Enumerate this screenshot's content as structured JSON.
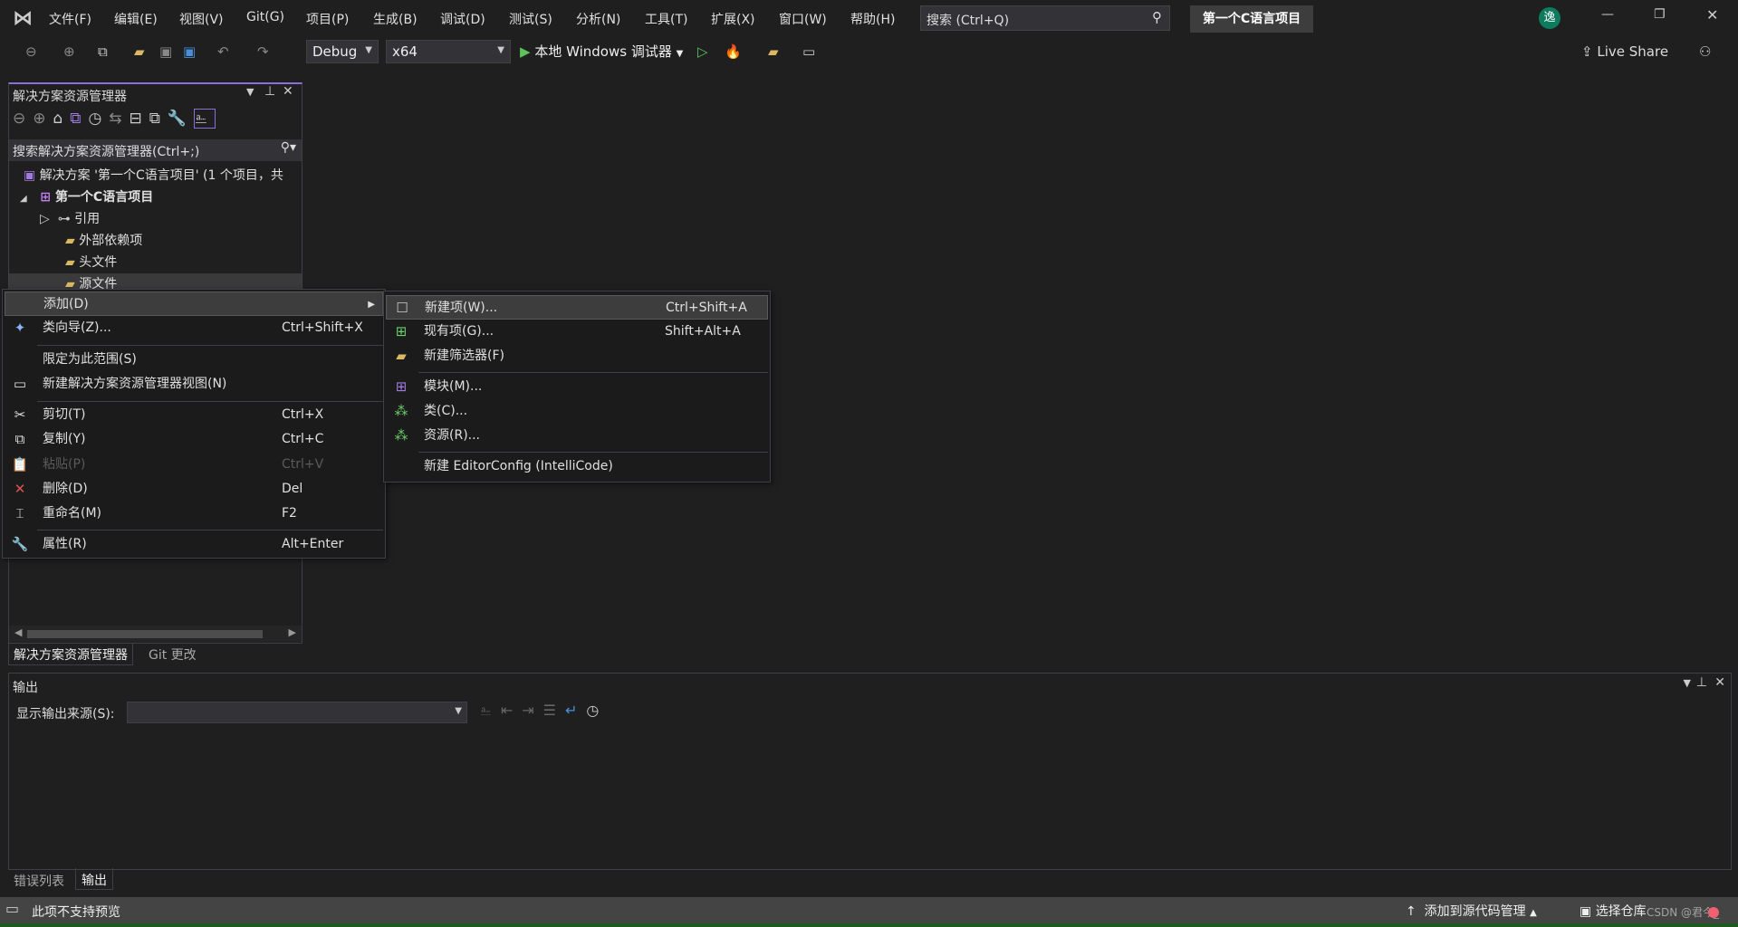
{
  "menubar": {
    "items": [
      "文件(F)",
      "编辑(E)",
      "视图(V)",
      "Git(G)",
      "项目(P)",
      "生成(B)",
      "调试(D)",
      "测试(S)",
      "分析(N)",
      "工具(T)",
      "扩展(X)",
      "窗口(W)",
      "帮助(H)"
    ],
    "search_placeholder": "搜索 (Ctrl+Q)",
    "project_title": "第一个C语言项目",
    "avatar": "逸"
  },
  "toolbar": {
    "config": "Debug",
    "platform": "x64",
    "run_label": "本地 Windows 调试器",
    "live_share": "Live Share"
  },
  "solution_explorer": {
    "title": "解决方案资源管理器",
    "search_placeholder": "搜索解决方案资源管理器(Ctrl+;)",
    "tree": [
      "解决方案 '第一个C语言项目' (1 个项目，共",
      "第一个C语言项目",
      "引用",
      "外部依赖项",
      "头文件",
      "源文件"
    ],
    "tabs": [
      "解决方案资源管理器",
      "Git 更改"
    ]
  },
  "context_menu": {
    "items": [
      {
        "label": "添加(D)",
        "shortcut": ""
      },
      {
        "label": "类向导(Z)...",
        "shortcut": "Ctrl+Shift+X"
      },
      {
        "label": "限定为此范围(S)",
        "shortcut": ""
      },
      {
        "label": "新建解决方案资源管理器视图(N)",
        "shortcut": ""
      },
      {
        "label": "剪切(T)",
        "shortcut": "Ctrl+X"
      },
      {
        "label": "复制(Y)",
        "shortcut": "Ctrl+C"
      },
      {
        "label": "粘贴(P)",
        "shortcut": "Ctrl+V",
        "disabled": true
      },
      {
        "label": "删除(D)",
        "shortcut": "Del"
      },
      {
        "label": "重命名(M)",
        "shortcut": "F2"
      },
      {
        "label": "属性(R)",
        "shortcut": "Alt+Enter"
      }
    ]
  },
  "submenu": {
    "items": [
      {
        "label": "新建项(W)...",
        "shortcut": "Ctrl+Shift+A"
      },
      {
        "label": "现有项(G)...",
        "shortcut": "Shift+Alt+A"
      },
      {
        "label": "新建筛选器(F)",
        "shortcut": ""
      },
      {
        "label": "模块(M)...",
        "shortcut": ""
      },
      {
        "label": "类(C)...",
        "shortcut": ""
      },
      {
        "label": "资源(R)...",
        "shortcut": ""
      },
      {
        "label": "新建 EditorConfig (IntelliCode)",
        "shortcut": ""
      }
    ]
  },
  "output": {
    "title": "输出",
    "source_label": "显示输出来源(S):",
    "source_value": ""
  },
  "bottom_tabs": [
    "错误列表",
    "输出"
  ],
  "statusbar": {
    "message": "此项不支持预览",
    "source_control": "添加到源代码管理",
    "repo": "选择仓库",
    "watermark": "CSDN @君今_"
  },
  "colors": {
    "accent": "#8a6fd6",
    "statusbar": "#444444",
    "status_strip": "#1e5a1e",
    "delete": "#e05252"
  }
}
